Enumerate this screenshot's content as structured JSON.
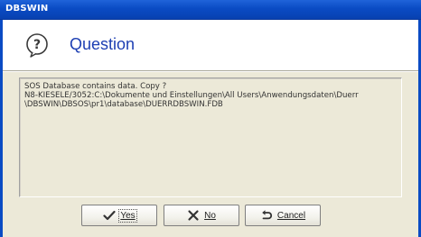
{
  "window": {
    "title": "DBSWIN"
  },
  "header": {
    "icon": "question-icon",
    "title": "Question"
  },
  "message": {
    "lines": [
      "SOS Database contains data. Copy ?",
      "N8-KIESELE/3052:C:\\Dokumente und Einstellungen\\All Users\\Anwendungsdaten\\Duerr",
      "\\DBSWIN\\DBSOS\\pr1\\database\\DUERRDBSWIN.FDB"
    ]
  },
  "buttons": {
    "yes": {
      "label": "Yes",
      "icon": "checkmark-icon"
    },
    "no": {
      "label": "No",
      "icon": "x-icon"
    },
    "cancel": {
      "label": "Cancel",
      "icon": "undo-arrow-icon"
    }
  },
  "colors": {
    "titlebar": "#0a4bc4",
    "header_title": "#1d3fb3",
    "dialog_background": "#ece9d8"
  }
}
